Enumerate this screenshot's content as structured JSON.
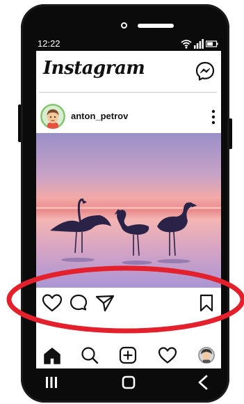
{
  "status_bar": {
    "time": "12:22",
    "icons": [
      "wifi-icon",
      "signal-icon",
      "battery-icon"
    ]
  },
  "header": {
    "app_name": "Instagram",
    "messenger_icon": "messenger-icon"
  },
  "post": {
    "username": "anton_petrov",
    "more_icon": "vertical-ellipsis-icon",
    "image_subject": "flamingos-at-sunset",
    "actions": [
      "heart-icon",
      "comment-icon",
      "send-icon",
      "bookmark-icon"
    ]
  },
  "bottom_nav": {
    "items": [
      "home-icon",
      "search-icon",
      "add-post-icon",
      "activity-heart-icon",
      "profile-avatar"
    ]
  },
  "system_nav": {
    "items": [
      "recent-apps-icon",
      "home-button-icon",
      "back-icon"
    ]
  },
  "colors": {
    "highlight_red": "#e3202b",
    "phone_body": "#0b0b0b",
    "sky_top": "#9a8fc9",
    "sky_mid": "#f09ea0",
    "water_bottom": "#a995d4"
  }
}
